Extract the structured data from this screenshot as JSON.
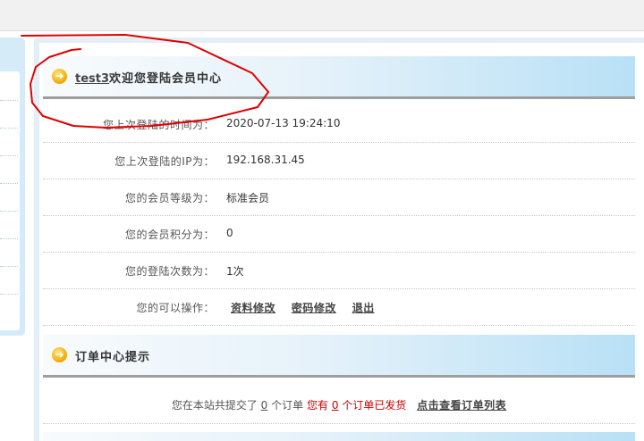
{
  "welcome": {
    "username": "test3",
    "title_suffix": "欢迎您登陆会员中心"
  },
  "info_rows": [
    {
      "label": "您上次登陆的时间为：",
      "value": "2020-07-13 19:24:10"
    },
    {
      "label": "您上次登陆的IP为：",
      "value": "192.168.31.45"
    },
    {
      "label": "您的会员等级为：",
      "value": "标准会员"
    },
    {
      "label": "您的会员积分为：",
      "value": "0"
    },
    {
      "label": "您的登陆次数为：",
      "value": "1次"
    }
  ],
  "operations": {
    "label": "您的可以操作：",
    "edit_profile": "资料修改",
    "change_password": "密码修改",
    "logout": "退出"
  },
  "order_center": {
    "title": "订单中心提示",
    "text_prefix": "您在本站共提交了",
    "total_orders": "0",
    "text_mid": "个订单",
    "shipped_prefix": "您有",
    "shipped_count": "0",
    "shipped_suffix": "个订单已发货",
    "view_link": "点击查看订单列表"
  },
  "icons": {
    "section_icon": "arrow-right-circle-icon"
  },
  "colors": {
    "header_gradient_end": "#b8e0f6",
    "annotation": "#e00000",
    "highlight_red": "#cc0000"
  }
}
